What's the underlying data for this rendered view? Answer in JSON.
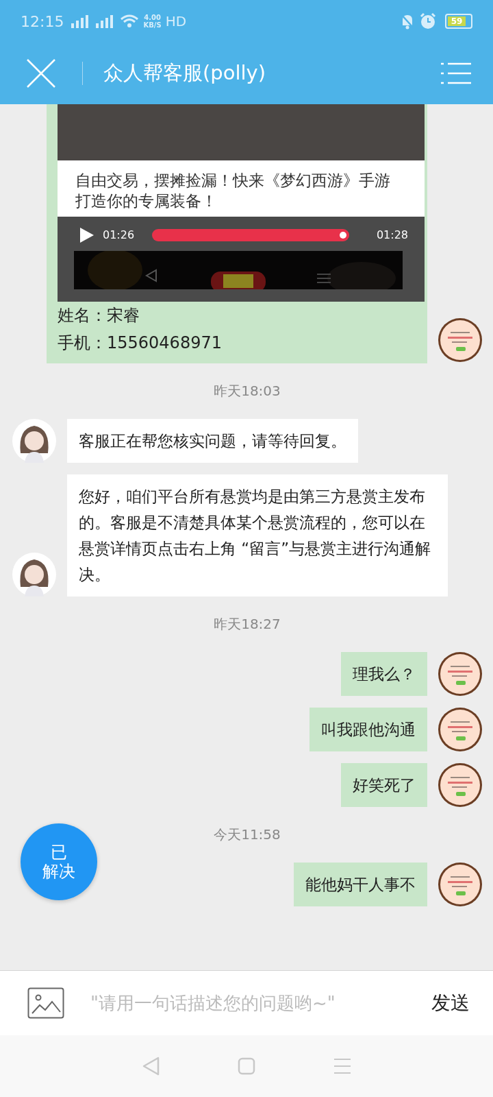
{
  "status_bar": {
    "time": "12:15",
    "net_speed_value": "4.00",
    "net_speed_unit": "KB/S",
    "hd": "HD",
    "battery": "59"
  },
  "header": {
    "title": "众人帮客服(polly)"
  },
  "messages": [
    {
      "kind": "sent_media",
      "screenshot": {
        "caption": "自由交易，摆摊捡漏！快来《梦幻西游》手游打造你的专属装备！",
        "elapsed": "01:26",
        "duration": "01:28",
        "level": 0.96
      },
      "lines": [
        "姓名：宋睿",
        "手机：15560468971"
      ]
    },
    {
      "kind": "time",
      "text": "昨天18:03"
    },
    {
      "kind": "received",
      "text": "客服正在帮您核实问题，请等待回复。"
    },
    {
      "kind": "received",
      "text": "您好，咱们平台所有悬赏均是由第三方悬赏主发布的。客服是不清楚具体某个悬赏流程的，您可以在悬赏详情页点击右上角 “留言”与悬赏主进行沟通解决。"
    },
    {
      "kind": "time",
      "text": "昨天18:27"
    },
    {
      "kind": "sent",
      "text": "理我么？"
    },
    {
      "kind": "sent",
      "text": "叫我跟他沟通"
    },
    {
      "kind": "sent",
      "text": "好笑死了"
    },
    {
      "kind": "time",
      "text": "今天11:58"
    },
    {
      "kind": "sent",
      "text": "能他妈干人事不"
    }
  ],
  "resolve_button": {
    "lines": [
      "已",
      "解决"
    ]
  },
  "input": {
    "placeholder": "\"请用一句话描述您的问题哟~\"",
    "send": "发送"
  }
}
